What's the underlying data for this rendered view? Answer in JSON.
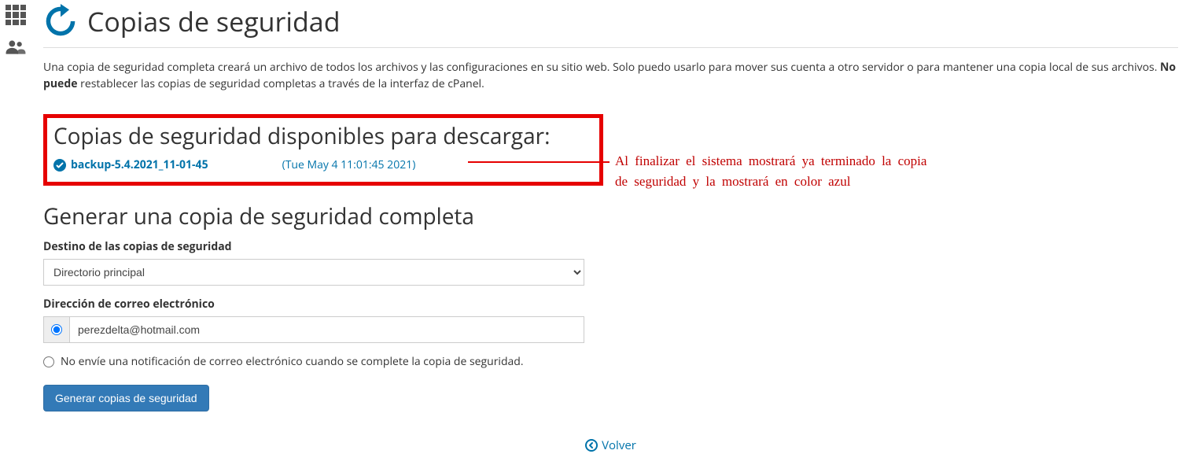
{
  "sidebar": {
    "apps_icon": "apps-grid",
    "users_icon": "users"
  },
  "header": {
    "title": "Copias de seguridad"
  },
  "intro": {
    "text1": "Una copia de seguridad completa creará un archivo de todos los archivos y las configuraciones en su sitio web. Solo puedo usarlo para mover sus cuenta a otro servidor o para mantener una copia local de sus archivos. ",
    "strong": "No puede",
    "text2": " restablecer las copias de seguridad completas a través de la interfaz de cPanel."
  },
  "available": {
    "heading": "Copias de seguridad disponibles para descargar:",
    "items": [
      {
        "name": "backup-5.4.2021_11-01-45",
        "date": "(Tue May 4 11:01:45 2021)"
      }
    ]
  },
  "annotation": "Al finalizar el sistema mostrará ya terminado la copia de seguridad y la mostrará en color azul",
  "generate": {
    "heading": "Generar una copia de seguridad completa",
    "dest_label": "Destino de las copias de seguridad",
    "dest_value": "Directorio principal",
    "email_label": "Dirección de correo electrónico",
    "email_value": "perezdelta@hotmail.com",
    "no_notify_label": "No envíe una notificación de correo electrónico cuando se complete la copia de seguridad.",
    "button": "Generar copias de seguridad"
  },
  "back_link": "Volver"
}
